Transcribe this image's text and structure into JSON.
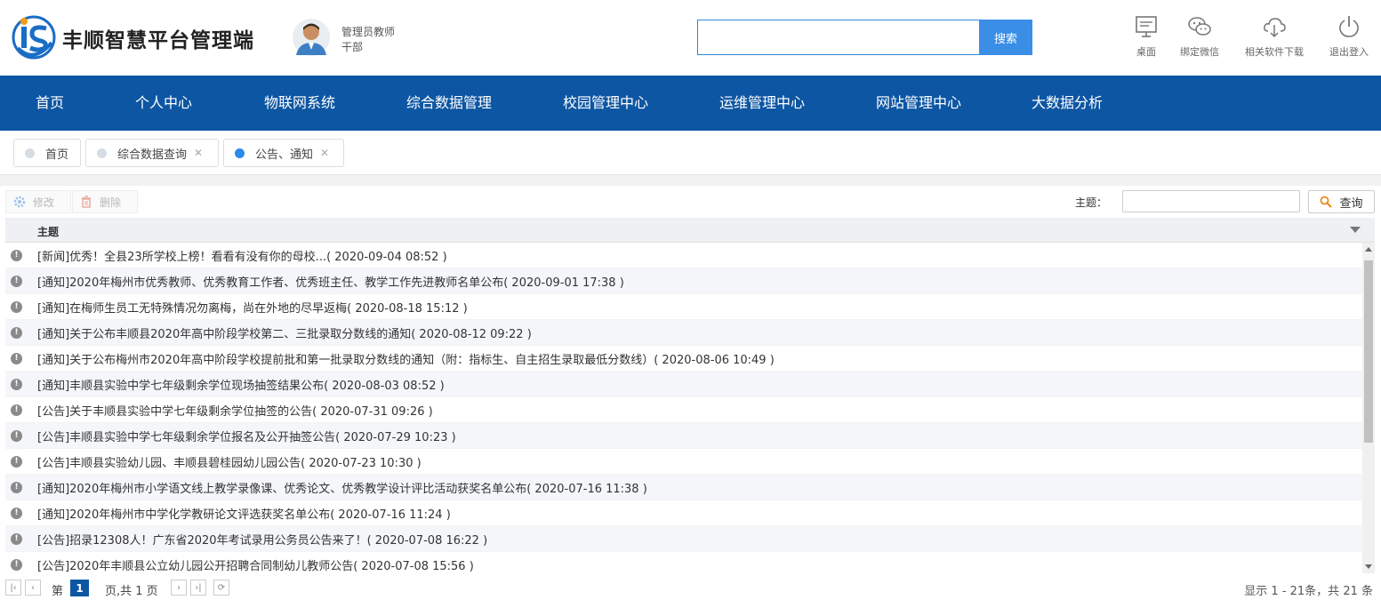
{
  "header": {
    "brand": "丰顺智慧平台管理端",
    "user_name": "管理员教师",
    "user_dept": "干部",
    "search_placeholder": "",
    "search_button": "搜索",
    "tools": [
      {
        "label": "桌面",
        "icon": "desktop-icon"
      },
      {
        "label": "绑定微信",
        "icon": "wechat-icon"
      },
      {
        "label": "相关软件下载",
        "icon": "cloud-download-icon"
      },
      {
        "label": "退出登入",
        "icon": "power-icon"
      }
    ]
  },
  "nav": [
    "首页",
    "个人中心",
    "物联网系统",
    "综合数据管理",
    "校园管理中心",
    "运维管理中心",
    "网站管理中心",
    "大数据分析"
  ],
  "tabs": [
    {
      "label": "首页",
      "closable": false,
      "active": false
    },
    {
      "label": "综合数据查询",
      "closable": true,
      "active": false
    },
    {
      "label": "公告、通知",
      "closable": true,
      "active": true
    }
  ],
  "toolbar": {
    "edit_label": "修改",
    "delete_label": "删除",
    "query_label": "主题：",
    "query_value": "",
    "query_button": "查询"
  },
  "grid": {
    "column": "主题",
    "rows": [
      "[新闻]优秀！全县23所学校上榜！看看有没有你的母校...( 2020-09-04 08:52 )",
      "[通知]2020年梅州市优秀教师、优秀教育工作者、优秀班主任、教学工作先进教师名单公布( 2020-09-01 17:38 )",
      "[通知]在梅师生员工无特殊情况勿离梅，尚在外地的尽早返梅( 2020-08-18 15:12 )",
      "[通知]关于公布丰顺县2020年高中阶段学校第二、三批录取分数线的通知( 2020-08-12 09:22 )",
      "[通知]关于公布梅州市2020年高中阶段学校提前批和第一批录取分数线的通知（附：指标生、自主招生录取最低分数线）( 2020-08-06 10:49 )",
      "[通知]丰顺县实验中学七年级剩余学位现场抽签结果公布( 2020-08-03 08:52 )",
      "[公告]关于丰顺县实验中学七年级剩余学位抽签的公告( 2020-07-31 09:26 )",
      "[公告]丰顺县实验中学七年级剩余学位报名及公开抽签公告( 2020-07-29 10:23 )",
      "[公告]丰顺县实验幼儿园、丰顺县碧桂园幼儿园公告( 2020-07-23 10:30 )",
      "[通知]2020年梅州市小学语文线上教学录像课、优秀论文、优秀教学设计评比活动获奖名单公布( 2020-07-16 11:38 )",
      "[通知]2020年梅州市中学化学教研论文评选获奖名单公布( 2020-07-16 11:24 )",
      "[公告]招录12308人！广东省2020年考试录用公务员公告来了！( 2020-07-08 16:22 )",
      "[公告]2020年丰顺县公立幼儿园公开招聘合同制幼儿教师公告( 2020-07-08 15:56 )"
    ]
  },
  "pager": {
    "page_prefix": "第",
    "page": "1",
    "page_suffix": "页,共 1 页",
    "info": "显示 1 - 21条，共 21 条"
  }
}
